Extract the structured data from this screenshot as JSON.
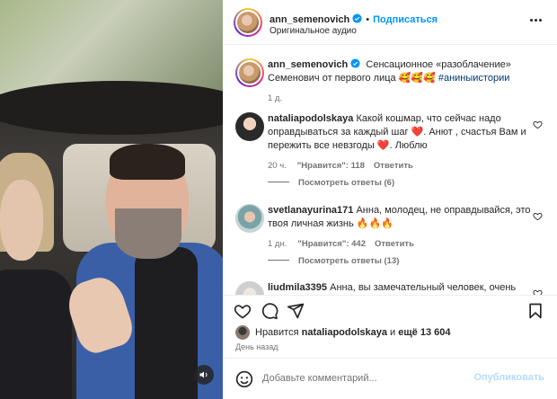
{
  "post": {
    "author": "ann_semenovich",
    "follow_label": "Подписаться",
    "separator": "•",
    "audio": "Оригинальное аудио"
  },
  "caption": {
    "username": "ann_semenovich",
    "text": "Сенсационное «разоблачение» Семенович от первого лица 🥰🥰🥰",
    "hashtag": "#аниныистории",
    "time": "1 д."
  },
  "comments": [
    {
      "username": "nataliapodolskaya",
      "text": "Какой кошмар, что сейчас надо оправдываться за каждый шаг ❤️. Анют , счастья Вам и пережить все невзгоды ❤️. Люблю",
      "time": "20 ч.",
      "likes": "\"Нравится\": 118",
      "reply": "Ответить",
      "view_replies": "Посмотреть ответы (6)"
    },
    {
      "username": "svetlanayurina171",
      "text": "Анна, молодец, не оправдывайся, это твоя личная жизнь 🔥🔥🔥",
      "time": "1 дн.",
      "likes": "\"Нравится\": 442",
      "reply": "Ответить",
      "view_replies": "Посмотреть ответы (13)"
    },
    {
      "username": "liudmila3395",
      "text": "Анна, вы замечательный человек, очень"
    }
  ],
  "likes_row": {
    "prefix": "Нравится",
    "user": "nataliapodolskaya",
    "middle": "и",
    "rest": "ещё 13 604"
  },
  "date": "День назад",
  "add_comment": {
    "placeholder": "Добавьте комментарий...",
    "publish": "Опубликовать"
  },
  "icons": {
    "like": "heart-icon",
    "comment": "comment-icon",
    "share": "send-icon",
    "save": "bookmark-icon",
    "emoji": "smiley-icon",
    "sound": "speaker-icon",
    "more": "more-dots-icon",
    "verified": "verified-badge-icon"
  },
  "colors": {
    "accent": "#0095f6",
    "link": "#00376b",
    "muted": "#737373",
    "publish_disabled": "#b3dbff"
  }
}
